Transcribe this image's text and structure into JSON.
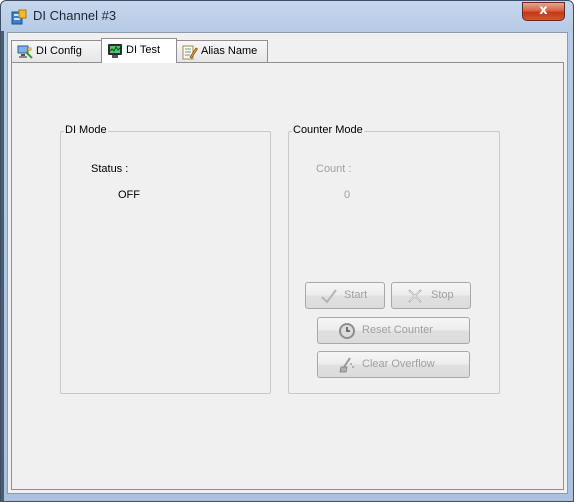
{
  "window": {
    "title": "DI Channel #3",
    "close_glyph": "x",
    "icon": "app-icon"
  },
  "tabs": [
    {
      "label": "DI Config",
      "icon": "network-config-icon",
      "active": false
    },
    {
      "label": "DI Test",
      "icon": "monitor-test-icon",
      "active": true
    },
    {
      "label": "Alias Name",
      "icon": "notepad-pencil-icon",
      "active": false
    }
  ],
  "di_mode": {
    "title": "DI Mode",
    "status_label": "Status :",
    "status_value": "OFF"
  },
  "counter_mode": {
    "title": "Counter Mode",
    "count_label": "Count :",
    "count_value": "0",
    "buttons": {
      "start": {
        "label": "Start",
        "icon": "check-icon",
        "enabled": false
      },
      "stop": {
        "label": "Stop",
        "icon": "cross-icon",
        "enabled": false
      },
      "reset": {
        "label": "Reset Counter",
        "icon": "reset-icon",
        "enabled": false
      },
      "clear": {
        "label": "Clear Overflow",
        "icon": "broom-icon",
        "enabled": false
      }
    }
  },
  "colors": {
    "disabled_text": "#a0a0a0",
    "panel_bg": "#f0f0f0",
    "close_red": "#c2381a"
  }
}
